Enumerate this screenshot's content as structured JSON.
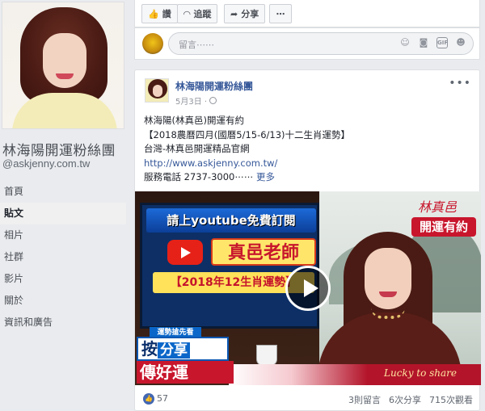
{
  "page": {
    "name": "林海陽開運粉絲團",
    "handle": "@askjenny.com.tw"
  },
  "nav": {
    "items": [
      "首頁",
      "貼文",
      "相片",
      "社群",
      "影片",
      "關於",
      "資訊和廣告"
    ],
    "active_index": 1
  },
  "actions": {
    "like_label": "讚",
    "follow_label": "追蹤",
    "share_label": "分享",
    "more_label": "⋯"
  },
  "comment": {
    "placeholder": "留言⋯⋯"
  },
  "post": {
    "author": "林海陽開運粉絲團",
    "date": "5月3日 · ",
    "text_lines": [
      "林海陽(林真邑)開運有約",
      "【2018農曆四月(國曆5/15-6/13)十二生肖運勢】",
      "台灣-林真邑開運精品官網"
    ],
    "link": "http://www.askjenny.com.tw/",
    "phone_line": "服務電話 2737-3000⋯⋯ ",
    "more": "更多",
    "video": {
      "yt_title": "請上youtube免費訂閱",
      "teacher": "真邑老師",
      "year_title": "【2018年12生肖運勢】",
      "brand_sig": "林真邑",
      "brand_label": "開運有約",
      "banner_top": "運勢搶先看",
      "banner1_a": "按",
      "banner1_b": "分享",
      "banner2": "傳好運",
      "lucky": "Lucky to share"
    },
    "likes": "57",
    "comments": "3則留言",
    "shares": "6次分享",
    "views": "715次觀看"
  },
  "colors": {
    "link": "#365899",
    "background": "#e9ebee",
    "like_blue": "#4267b2"
  }
}
